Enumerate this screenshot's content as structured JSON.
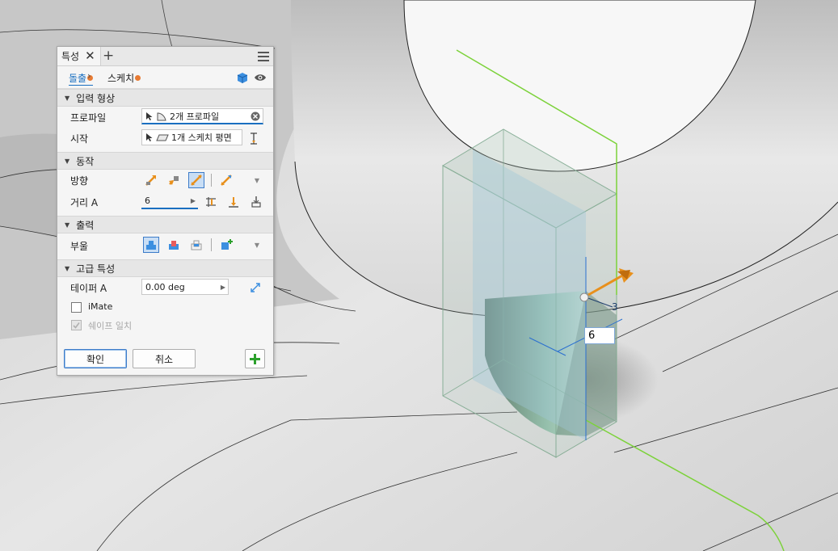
{
  "panel": {
    "tab_label": "특성",
    "close_glyph": "✕",
    "add_glyph": "+",
    "breadcrumb": {
      "feature": "돌출",
      "sep": "›",
      "sketch": "스케치"
    },
    "sections": {
      "input": "입력 형상",
      "behavior": "동작",
      "output": "출력",
      "advanced": "고급 특성"
    },
    "profile_label": "프로파일",
    "profile_value": "2개 프로파일",
    "start_label": "시작",
    "start_value": "1개 스케치 평면",
    "direction_label": "방향",
    "distance_label": "거리 A",
    "distance_value": "6",
    "boolean_label": "부울",
    "taper_label": "테이퍼 A",
    "taper_value": "0.00 deg",
    "imate_label": "iMate",
    "imate_checked": false,
    "shape_match_label": "쉐이프 일치",
    "shape_match_checked": true,
    "ok_label": "확인",
    "cancel_label": "취소",
    "add_label": "+"
  },
  "viewport": {
    "dimension_input_value": "6",
    "dimension_text": "3"
  },
  "colors": {
    "accent": "#1a6fc0",
    "sketch_line": "#7cd23a",
    "manipulator": "#e8901c",
    "preview_fill": "#9fc7d8"
  }
}
